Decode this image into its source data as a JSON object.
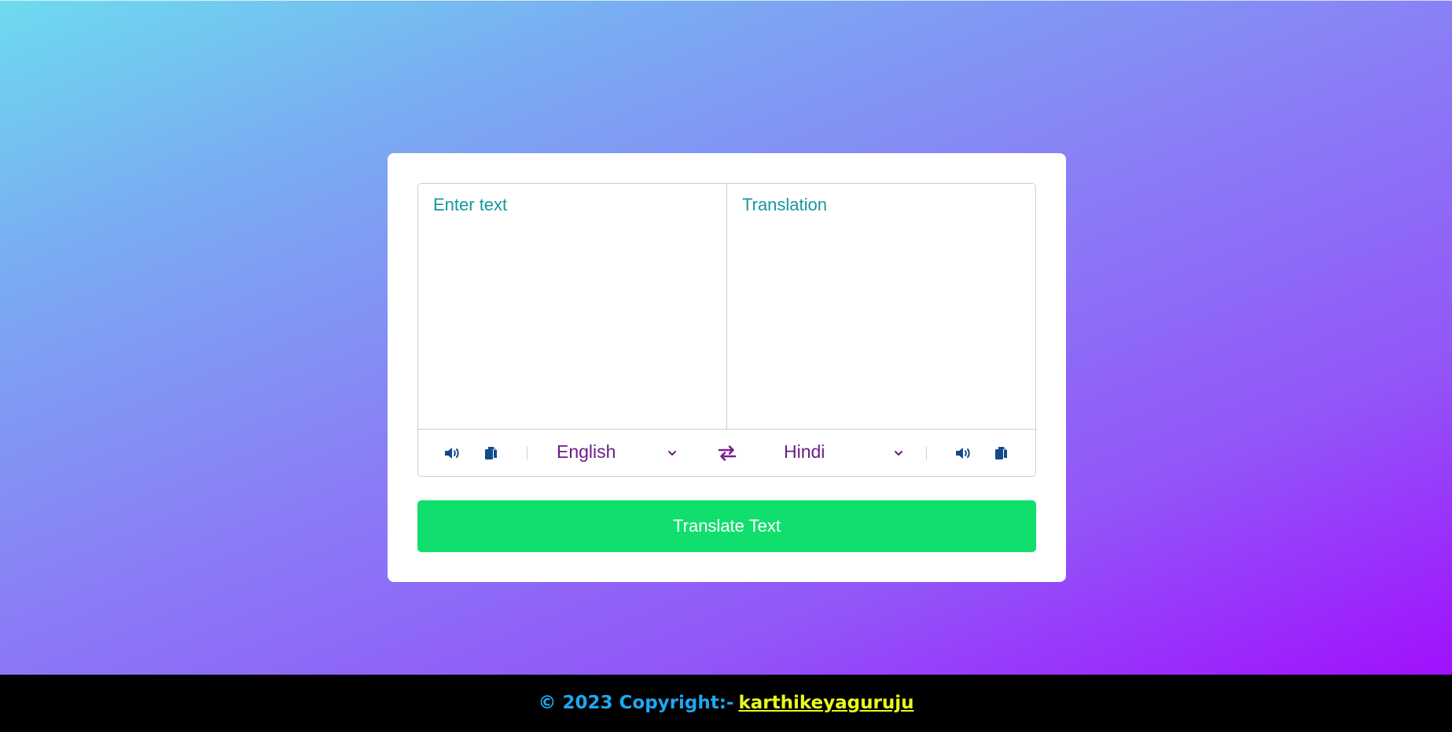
{
  "colors": {
    "accent_teal": "#16989b",
    "language_text": "#6b1d87",
    "icon_blue": "#124a8c",
    "button_green": "#10df6d",
    "footer_text": "#1ea7f2",
    "footer_link": "#e8ff1a"
  },
  "translator": {
    "from_placeholder": "Enter text",
    "from_value": "",
    "to_placeholder": "Translation",
    "to_value": "",
    "from_language": "English",
    "to_language": "Hindi",
    "icons": {
      "from_speak": "volume-icon",
      "from_copy": "copy-icon",
      "exchange": "exchange-arrows-icon",
      "to_speak": "volume-icon",
      "to_copy": "copy-icon",
      "dropdown": "chevron-down-icon"
    },
    "translate_button": "Translate Text"
  },
  "footer": {
    "copyright": "© 2023 Copyright:-",
    "author_link": "karthikeyaguruju"
  }
}
